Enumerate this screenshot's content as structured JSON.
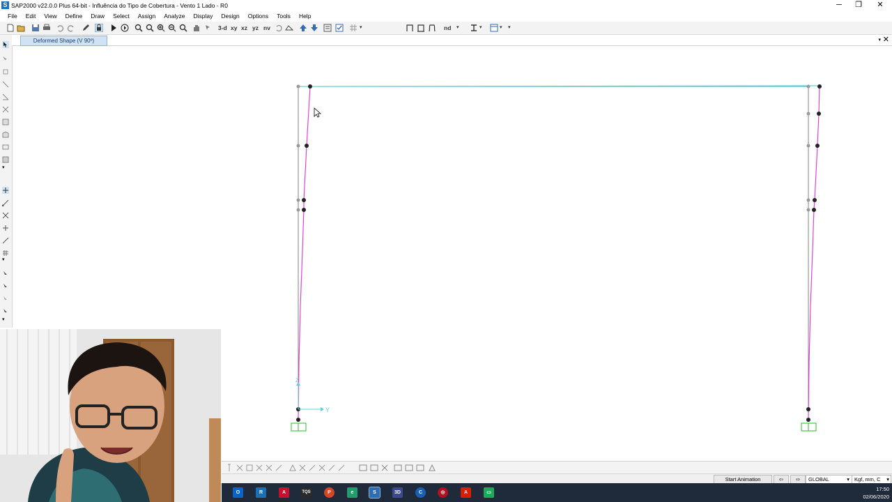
{
  "window": {
    "title": "SAP2000 v22.0.0 Plus 64-bit - Influência do Tipo de Cobertura - Vento 1 Lado - R0",
    "app_icon_letter": "S",
    "controls": {
      "minimize": "─",
      "maximize": "❐",
      "close": "✕"
    }
  },
  "menu": [
    "File",
    "Edit",
    "View",
    "Define",
    "Draw",
    "Select",
    "Assign",
    "Analyze",
    "Display",
    "Design",
    "Options",
    "Tools",
    "Help"
  ],
  "toolbar": {
    "view_3d": "3-d",
    "view_xy": "xy",
    "view_xz": "xz",
    "view_yz": "yz",
    "view_nv": "nv",
    "nd": "nd"
  },
  "tab": {
    "label": "Deformed Shape (V 90º)",
    "close": "✕",
    "dropdown": "▾"
  },
  "model": {
    "axis_z_label": "Z",
    "axis_y_label": "Y",
    "deformed_color": "#e040e0",
    "undeformed_color": "#808080",
    "beam_color": "#40c8d0",
    "support_color": "#20c020"
  },
  "status": {
    "start_animation": "Start Animation",
    "prev_icon": "left-arrow",
    "next_icon": "right-arrow",
    "coord_system": "GLOBAL",
    "units": "Kgf, mm, C"
  },
  "taskbar": {
    "time": "17:50",
    "date": "02/06/2020",
    "apps": [
      "outlook",
      "revit",
      "autocad",
      "tqs",
      "powerpoint",
      "eberick",
      "sap2000",
      "3d",
      "cype",
      "unknown",
      "acrobat",
      "chat"
    ]
  }
}
